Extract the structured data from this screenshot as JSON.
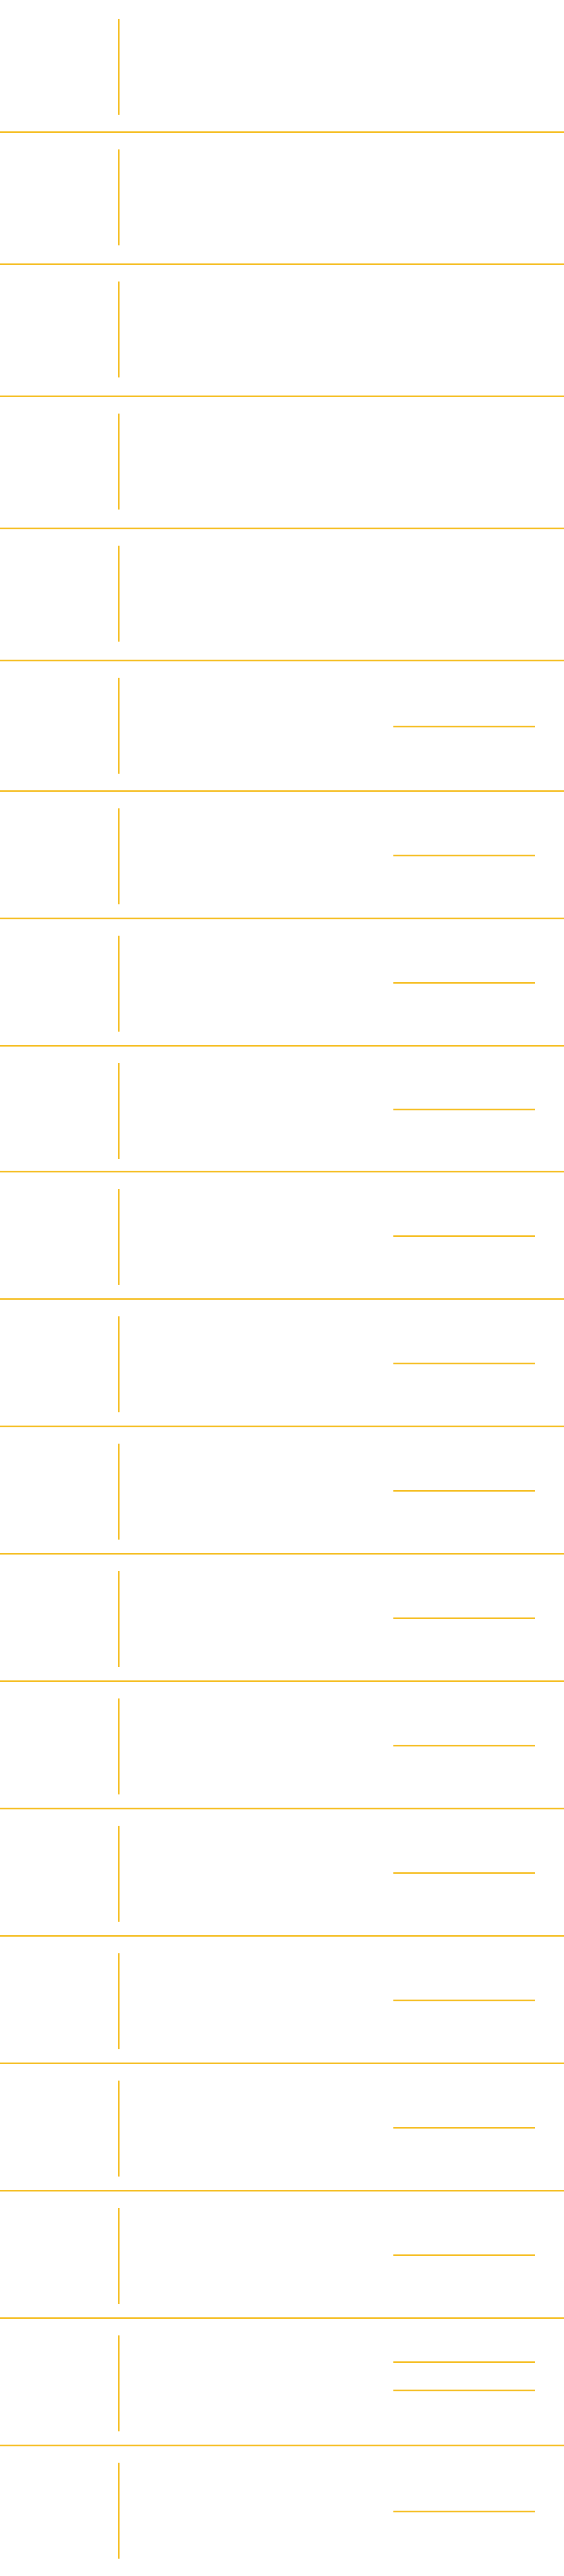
{
  "colors": {
    "accent": "#F5BD1F",
    "background": "#FFFFFF"
  },
  "rows": [
    {
      "fields": 0
    },
    {
      "fields": 0
    },
    {
      "fields": 0
    },
    {
      "fields": 0
    },
    {
      "fields": 0
    },
    {
      "fields": 1
    },
    {
      "fields": 1
    },
    {
      "fields": 1
    },
    {
      "fields": 1
    },
    {
      "fields": 1
    },
    {
      "fields": 1
    },
    {
      "fields": 1
    },
    {
      "fields": 1
    },
    {
      "fields": 1
    },
    {
      "fields": 1
    },
    {
      "fields": 1
    },
    {
      "fields": 1
    },
    {
      "fields": 1
    },
    {
      "fields": 2
    },
    {
      "fields": 1
    }
  ]
}
